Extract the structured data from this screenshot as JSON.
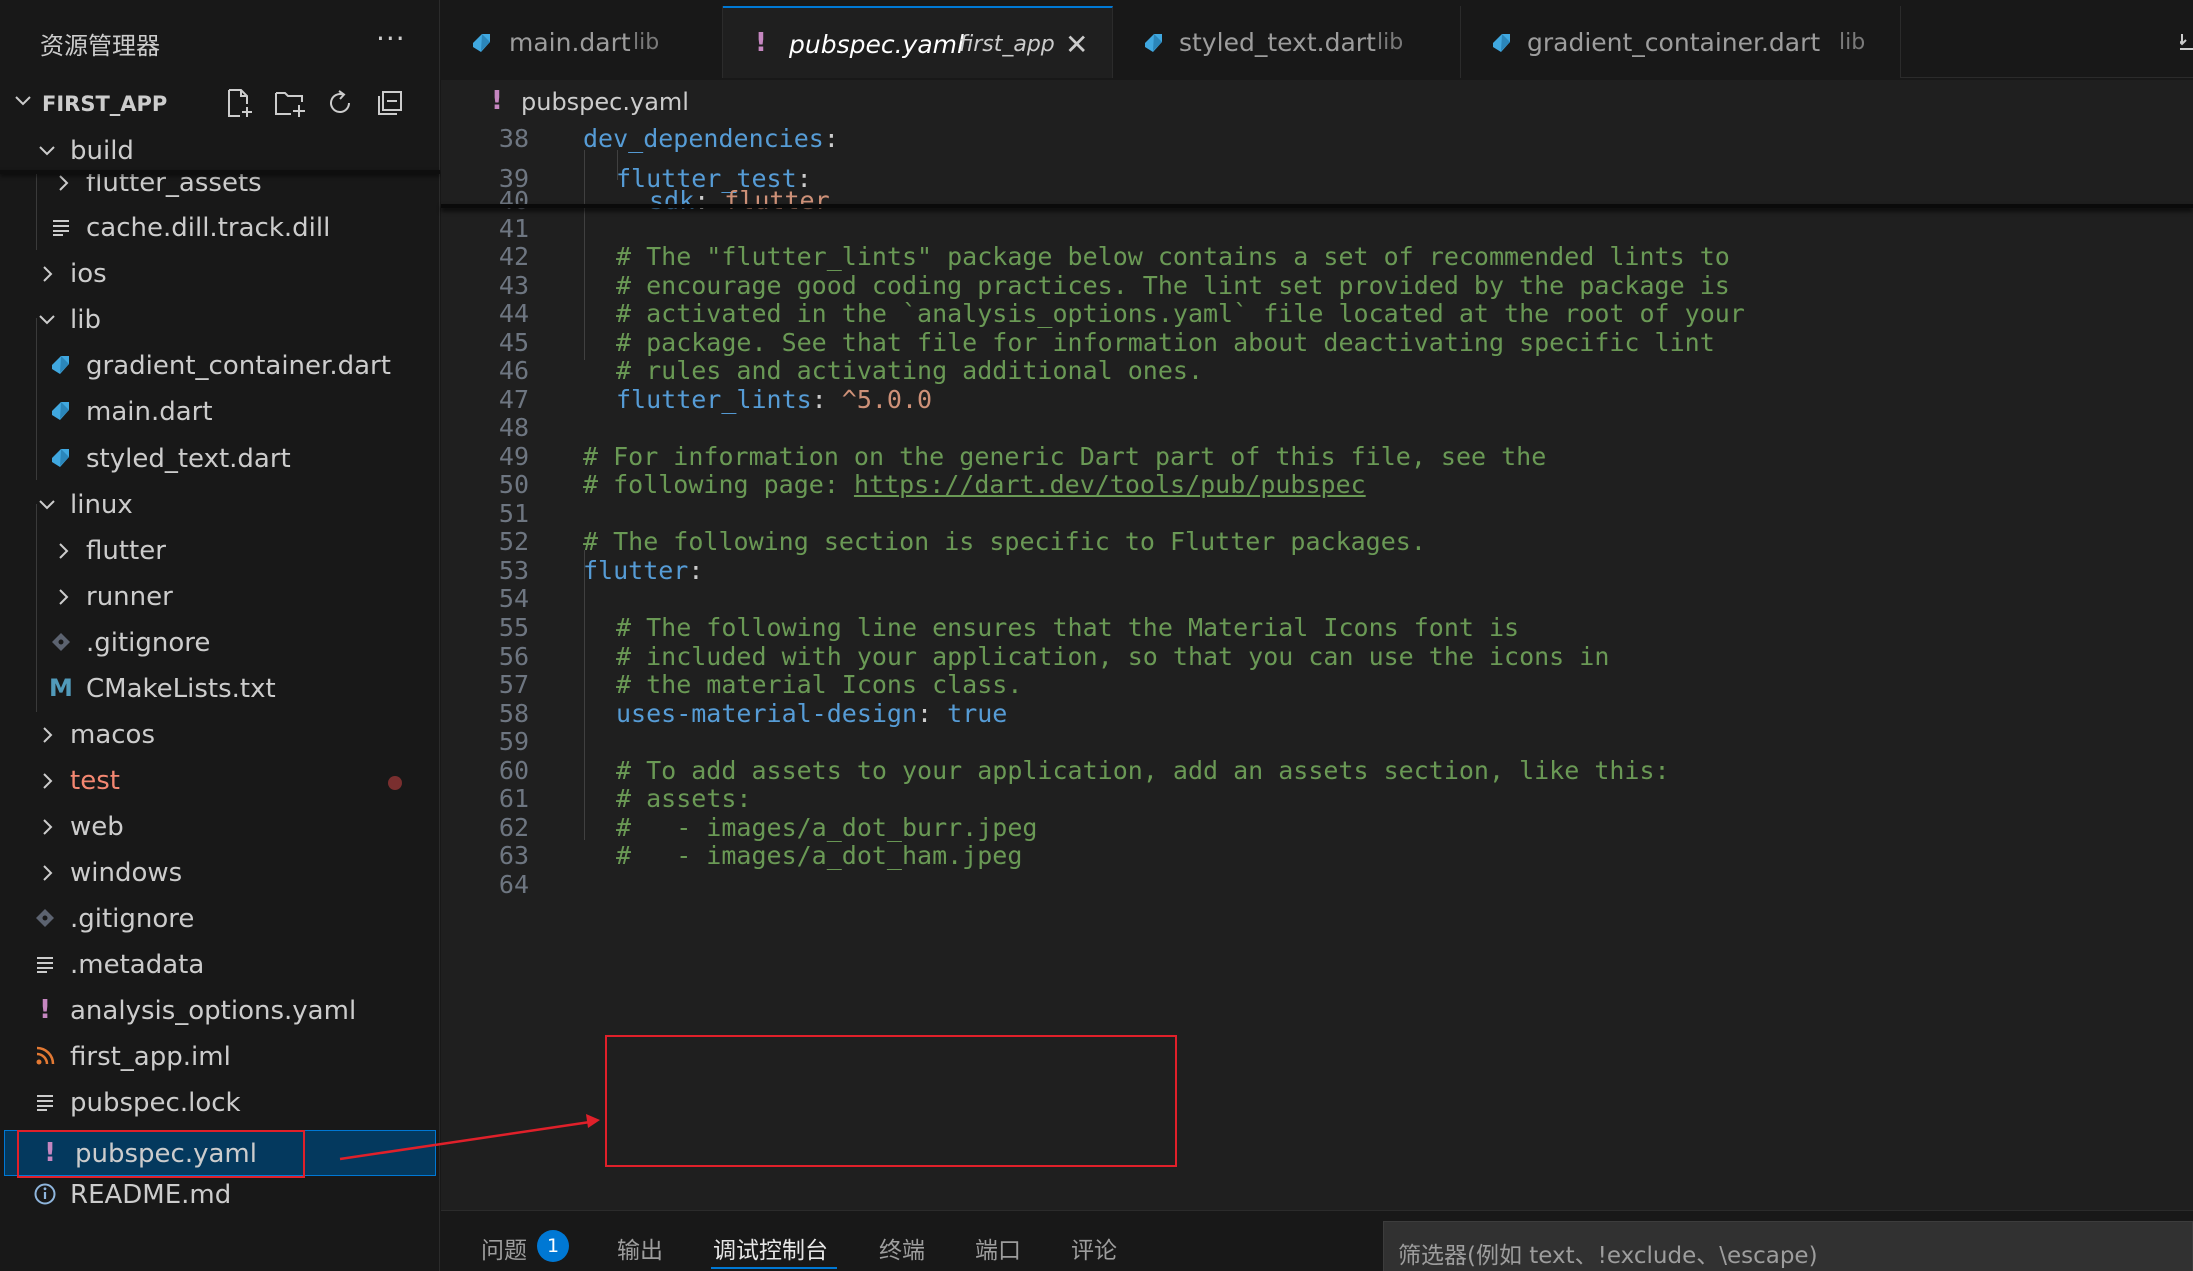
{
  "explorer": {
    "title": "资源管理器",
    "more": "···",
    "project": "FIRST_APP",
    "actions": [
      "new-file-icon",
      "new-folder-icon",
      "refresh-icon",
      "collapse-all-icon"
    ]
  },
  "tree": [
    {
      "label": "build",
      "type": "folder",
      "expanded": true,
      "level": 0
    },
    {
      "label": "flutter_assets",
      "type": "folder",
      "expanded": false,
      "level": 1
    },
    {
      "label": "cache.dill.track.dill",
      "type": "file",
      "icon": "lines-icon",
      "level": 1
    },
    {
      "label": "ios",
      "type": "folder",
      "expanded": false,
      "level": 0
    },
    {
      "label": "lib",
      "type": "folder",
      "expanded": true,
      "level": 0
    },
    {
      "label": "gradient_container.dart",
      "type": "file",
      "icon": "dart-icon",
      "level": 1
    },
    {
      "label": "main.dart",
      "type": "file",
      "icon": "dart-icon",
      "level": 1
    },
    {
      "label": "styled_text.dart",
      "type": "file",
      "icon": "dart-icon",
      "level": 1
    },
    {
      "label": "linux",
      "type": "folder",
      "expanded": true,
      "level": 0
    },
    {
      "label": "flutter",
      "type": "folder",
      "expanded": false,
      "level": 1
    },
    {
      "label": "runner",
      "type": "folder",
      "expanded": false,
      "level": 1
    },
    {
      "label": ".gitignore",
      "type": "file",
      "icon": "git-icon",
      "level": 1
    },
    {
      "label": "CMakeLists.txt",
      "type": "file",
      "icon": "cmake-icon",
      "level": 1
    },
    {
      "label": "macos",
      "type": "folder",
      "expanded": false,
      "level": 0
    },
    {
      "label": "test",
      "type": "folder",
      "expanded": false,
      "level": 0,
      "status": "error"
    },
    {
      "label": "web",
      "type": "folder",
      "expanded": false,
      "level": 0
    },
    {
      "label": "windows",
      "type": "folder",
      "expanded": false,
      "level": 0
    },
    {
      "label": ".gitignore",
      "type": "file",
      "icon": "git-icon",
      "level": 0
    },
    {
      "label": ".metadata",
      "type": "file",
      "icon": "lines-icon",
      "level": 0
    },
    {
      "label": "analysis_options.yaml",
      "type": "file",
      "icon": "yaml-icon",
      "level": 0
    },
    {
      "label": "first_app.iml",
      "type": "file",
      "icon": "rss-icon",
      "level": 0
    },
    {
      "label": "pubspec.lock",
      "type": "file",
      "icon": "lines-icon",
      "level": 0
    },
    {
      "label": "pubspec.yaml",
      "type": "file",
      "icon": "yaml-icon",
      "level": 0,
      "selected": true
    },
    {
      "label": "README.md",
      "type": "file",
      "icon": "info-icon",
      "level": 0
    }
  ],
  "tabs": [
    {
      "name": "main.dart",
      "desc": "lib",
      "icon": "dart-icon",
      "active": false
    },
    {
      "name": "pubspec.yaml",
      "desc": "first_app",
      "icon": "yaml-icon",
      "active": true,
      "close": "✕"
    },
    {
      "name": "styled_text.dart",
      "desc": "lib",
      "icon": "dart-icon",
      "active": false
    },
    {
      "name": "gradient_container.dart",
      "desc": "lib",
      "icon": "dart-icon",
      "active": false
    }
  ],
  "breadcrumb": {
    "icon": "!",
    "file": "pubspec.yaml"
  },
  "editor": {
    "lines": [
      {
        "n": "38",
        "indent": 0,
        "parts": [
          [
            "key",
            "dev_dependencies"
          ],
          [
            "plain",
            ":"
          ]
        ]
      },
      {
        "n": "39",
        "indent": 1,
        "parts": [
          [
            "key",
            "flutter_test"
          ],
          [
            "plain",
            ":"
          ]
        ]
      },
      {
        "n": "40",
        "indent": 2,
        "parts": [
          [
            "key",
            "sdk"
          ],
          [
            "plain",
            ": "
          ],
          [
            "str",
            "flutter"
          ]
        ]
      },
      {
        "n": "41",
        "indent": 0,
        "parts": []
      },
      {
        "n": "42",
        "indent": 1,
        "parts": [
          [
            "comment",
            "# The \"flutter_lints\" package below contains a set of recommended lints to"
          ]
        ]
      },
      {
        "n": "43",
        "indent": 1,
        "parts": [
          [
            "comment",
            "# encourage good coding practices. The lint set provided by the package is"
          ]
        ]
      },
      {
        "n": "44",
        "indent": 1,
        "parts": [
          [
            "comment",
            "# activated in the `analysis_options.yaml` file located at the root of your"
          ]
        ]
      },
      {
        "n": "45",
        "indent": 1,
        "parts": [
          [
            "comment",
            "# package. See that file for information about deactivating specific lint"
          ]
        ]
      },
      {
        "n": "46",
        "indent": 1,
        "parts": [
          [
            "comment",
            "# rules and activating additional ones."
          ]
        ]
      },
      {
        "n": "47",
        "indent": 1,
        "parts": [
          [
            "key",
            "flutter_lints"
          ],
          [
            "plain",
            ": "
          ],
          [
            "str",
            "^5.0.0"
          ]
        ]
      },
      {
        "n": "48",
        "indent": 0,
        "parts": []
      },
      {
        "n": "49",
        "indent": 0,
        "parts": [
          [
            "comment",
            "# For information on the generic Dart part of this file, see the"
          ]
        ]
      },
      {
        "n": "50",
        "indent": 0,
        "parts": [
          [
            "comment",
            "# following page: "
          ],
          [
            "link",
            "https://dart.dev/tools/pub/pubspec"
          ]
        ]
      },
      {
        "n": "51",
        "indent": 0,
        "parts": []
      },
      {
        "n": "52",
        "indent": 0,
        "parts": [
          [
            "comment",
            "# The following section is specific to Flutter packages."
          ]
        ]
      },
      {
        "n": "53",
        "indent": 0,
        "parts": [
          [
            "key",
            "flutter"
          ],
          [
            "plain",
            ":"
          ]
        ]
      },
      {
        "n": "54",
        "indent": 0,
        "parts": []
      },
      {
        "n": "55",
        "indent": 1,
        "parts": [
          [
            "comment",
            "# The following line ensures that the Material Icons font is"
          ]
        ]
      },
      {
        "n": "56",
        "indent": 1,
        "parts": [
          [
            "comment",
            "# included with your application, so that you can use the icons in"
          ]
        ]
      },
      {
        "n": "57",
        "indent": 1,
        "parts": [
          [
            "comment",
            "# the material Icons class."
          ]
        ]
      },
      {
        "n": "58",
        "indent": 1,
        "parts": [
          [
            "key",
            "uses-material-design"
          ],
          [
            "plain",
            ": "
          ],
          [
            "kw",
            "true"
          ]
        ]
      },
      {
        "n": "59",
        "indent": 0,
        "parts": []
      },
      {
        "n": "60",
        "indent": 1,
        "parts": [
          [
            "comment",
            "# To add assets to your application, add an assets section, like this:"
          ]
        ]
      },
      {
        "n": "61",
        "indent": 1,
        "parts": [
          [
            "comment",
            "# assets:"
          ]
        ]
      },
      {
        "n": "62",
        "indent": 1,
        "parts": [
          [
            "comment",
            "#   - images/a_dot_burr.jpeg"
          ]
        ]
      },
      {
        "n": "63",
        "indent": 1,
        "parts": [
          [
            "comment",
            "#   - images/a_dot_ham.jpeg"
          ]
        ]
      },
      {
        "n": "64",
        "indent": 0,
        "parts": []
      }
    ]
  },
  "panel": {
    "tabs": [
      "问题",
      "输出",
      "调试控制台",
      "终端",
      "端口",
      "评论"
    ],
    "active": "调试控制台",
    "problems_count": "1",
    "filter_placeholder": "筛选器(例如 text、!exclude、\\escape)"
  },
  "colors": {
    "accent": "#0078d4",
    "selection": "#04395e",
    "annotation": "#e0202a",
    "yaml_icon": "#c586c0",
    "dart_icon": "#40a8e0",
    "error_text": "#f48771"
  }
}
